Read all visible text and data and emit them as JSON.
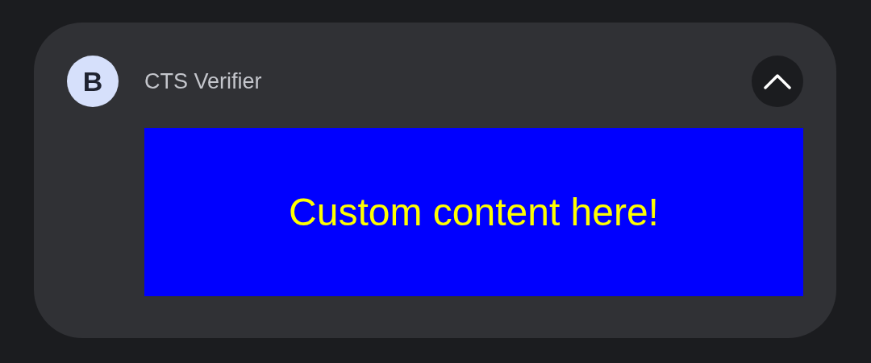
{
  "notification": {
    "app_icon_letter": "B",
    "app_name": "CTS Verifier",
    "expanded": true,
    "content": {
      "text": "Custom content here!"
    }
  }
}
